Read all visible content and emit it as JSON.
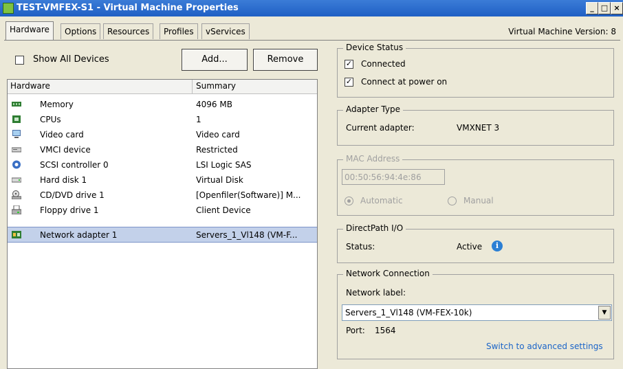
{
  "window": {
    "title": "TEST-VMFEX-S1 - Virtual Machine Properties"
  },
  "tabs": [
    {
      "label": "Hardware"
    },
    {
      "label": "Options"
    },
    {
      "label": "Resources"
    },
    {
      "label": "Profiles"
    },
    {
      "label": "vServices"
    }
  ],
  "vm_version": "Virtual Machine Version: 8",
  "toolbar": {
    "show_all_devices": "Show All Devices",
    "add_label": "Add...",
    "remove_label": "Remove"
  },
  "hardware_table": {
    "columns": [
      "Hardware",
      "Summary"
    ],
    "rows": [
      {
        "name": "Memory",
        "summary": "4096 MB",
        "icon": "memory-icon"
      },
      {
        "name": "CPUs",
        "summary": "1",
        "icon": "cpu-icon"
      },
      {
        "name": "Video card",
        "summary": "Video card",
        "icon": "monitor-icon"
      },
      {
        "name": "VMCI device",
        "summary": "Restricted",
        "icon": "device-icon"
      },
      {
        "name": "SCSI controller 0",
        "summary": "LSI Logic SAS",
        "icon": "scsi-icon"
      },
      {
        "name": "Hard disk 1",
        "summary": "Virtual Disk",
        "icon": "disk-icon"
      },
      {
        "name": "CD/DVD drive 1",
        "summary": "[Openfiler(Software)] M...",
        "icon": "cdrom-icon"
      },
      {
        "name": "Floppy drive 1",
        "summary": "Client Device",
        "icon": "floppy-icon"
      },
      {
        "name": "Network adapter 1",
        "summary": "Servers_1_Vl148 (VM-F...",
        "icon": "network-adapter-icon",
        "selected": true
      }
    ]
  },
  "device_status": {
    "legend": "Device Status",
    "connected": "Connected",
    "connect_at_power_on": "Connect at power on"
  },
  "adapter_type": {
    "legend": "Adapter Type",
    "label": "Current adapter:",
    "value": "VMXNET 3"
  },
  "mac_address": {
    "legend": "MAC Address",
    "value": "00:50:56:94:4e:86",
    "automatic": "Automatic",
    "manual": "Manual"
  },
  "directpath": {
    "legend": "DirectPath I/O",
    "label": "Status:",
    "value": "Active"
  },
  "network_connection": {
    "legend": "Network Connection",
    "label": "Network label:",
    "selected": "Servers_1_Vl148 (VM-FEX-10k)",
    "port_label": "Port:",
    "port_value": "1564",
    "advanced_link": "Switch to advanced settings"
  },
  "colors": {
    "title_bar": "#1f5fc4",
    "selection": "#c3d1ea",
    "link": "#1a64c8",
    "info": "#2b7fd4"
  }
}
